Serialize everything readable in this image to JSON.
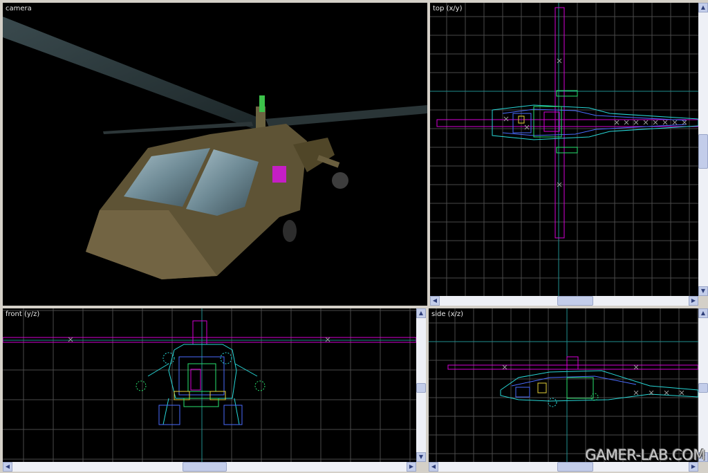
{
  "viewports": {
    "camera": {
      "label": "camera"
    },
    "top": {
      "label": "top (x/y)"
    },
    "front": {
      "label": "front (y/z)"
    },
    "side": {
      "label": "side (x/z)"
    }
  },
  "watermark": "GAMER-LAB.COM",
  "colors": {
    "background": "#000000",
    "grid": "#4a4a4a",
    "axis": "#1f8f8f",
    "rotor": "#d600d6",
    "wire_cyan": "#27d8d8",
    "wire_green": "#29e36f",
    "wire_blue": "#4a6cff",
    "wire_yellow": "#e6d23a",
    "frame": "#d4d0c8"
  },
  "icons": {
    "scroll_up": "triangle-up-icon",
    "scroll_down": "triangle-down-icon",
    "scroll_left": "triangle-left-icon",
    "scroll_right": "triangle-right-icon"
  }
}
